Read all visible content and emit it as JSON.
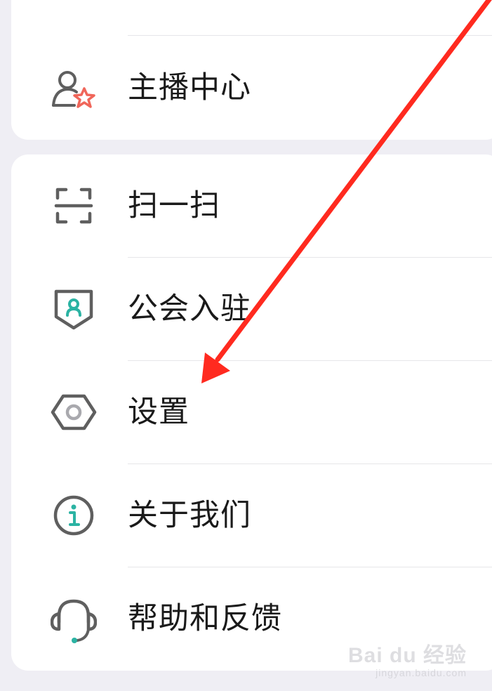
{
  "menu": {
    "partial_item": {
      "label": "...",
      "icon": "partial-icon"
    },
    "anchor_item": {
      "label": "主播中心",
      "icon": "anchor-star-icon"
    },
    "items": [
      {
        "label": "扫一扫",
        "icon": "scan-icon"
      },
      {
        "label": "公会入驻",
        "icon": "guild-shield-icon"
      },
      {
        "label": "设置",
        "icon": "settings-hexagon-icon"
      },
      {
        "label": "关于我们",
        "icon": "info-icon"
      },
      {
        "label": "帮助和反馈",
        "icon": "headset-icon"
      }
    ]
  },
  "colors": {
    "accent_teal": "#2bb3a3",
    "accent_coral": "#f0665a",
    "icon_gray": "#5f5f5f",
    "annotation_arrow": "#ff2a1f"
  },
  "watermark": {
    "brand": "Bai du 经验",
    "url": "jingyan.baidu.com"
  }
}
